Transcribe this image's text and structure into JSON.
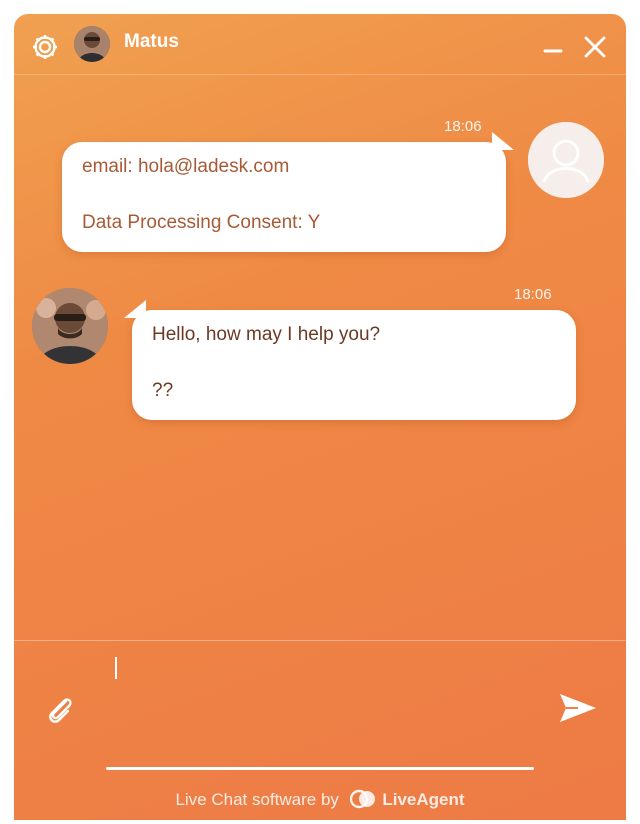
{
  "header": {
    "agent_name": "Matus",
    "icons": [
      "gear-icon",
      "minimize-icon",
      "close-icon"
    ]
  },
  "messages": [
    {
      "sender": "visitor",
      "time": "18:06",
      "lines": [
        "email: hola@ladesk.com",
        "Data Processing Consent: Y"
      ]
    },
    {
      "sender": "agent",
      "time": "18:06",
      "lines": [
        "Hello, how may I help you?",
        "??"
      ]
    }
  ],
  "composer": {
    "value": "",
    "icons": [
      "paperclip-icon",
      "send-icon"
    ]
  },
  "footer": {
    "text": "Live Chat software by",
    "brand": "LiveAgent"
  },
  "colors": {
    "accent": "#ef8a45",
    "bubble": "#ffffff",
    "visitor_text": "#a85a36",
    "agent_text": "#6a3a24"
  }
}
